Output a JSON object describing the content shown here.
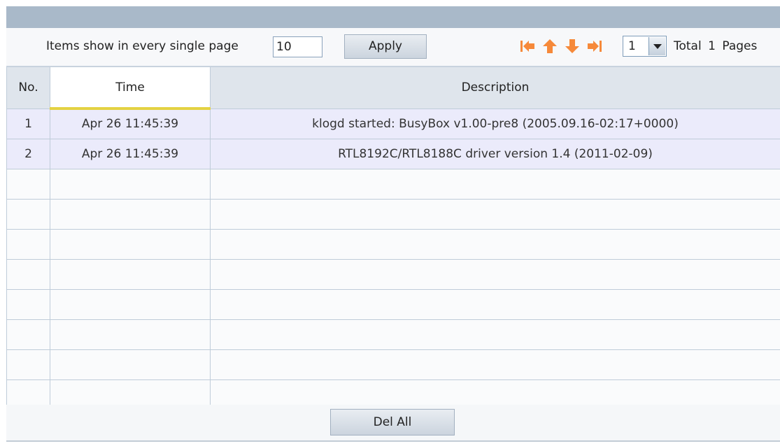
{
  "toolbar": {
    "items_label": "Items show in every single page",
    "page_size_value": "10",
    "apply_label": "Apply",
    "nav_icons": [
      "first-page-icon",
      "previous-page-icon",
      "next-page-icon",
      "last-page-icon"
    ],
    "page_select_value": "1",
    "total_label": "Total 1 Pages"
  },
  "table": {
    "headers": {
      "no": "No.",
      "time": "Time",
      "description": "Description"
    },
    "rows": [
      {
        "no": "1",
        "time": "Apr 26 11:45:39",
        "description": "klogd started: BusyBox v1.00-pre8 (2005.09.16-02:17+0000)"
      },
      {
        "no": "2",
        "time": "Apr 26 11:45:39",
        "description": "RTL8192C/RTL8188C driver version 1.4 (2011-02-09)"
      }
    ]
  },
  "footer": {
    "del_all_label": "Del All"
  },
  "colors": {
    "topbar": "#a9b9c9",
    "header_bg": "#dfe5ec",
    "active_header_underline": "#e4d242",
    "row_bg": "#ebebfb",
    "nav_icon_orange": "#f6893a"
  }
}
